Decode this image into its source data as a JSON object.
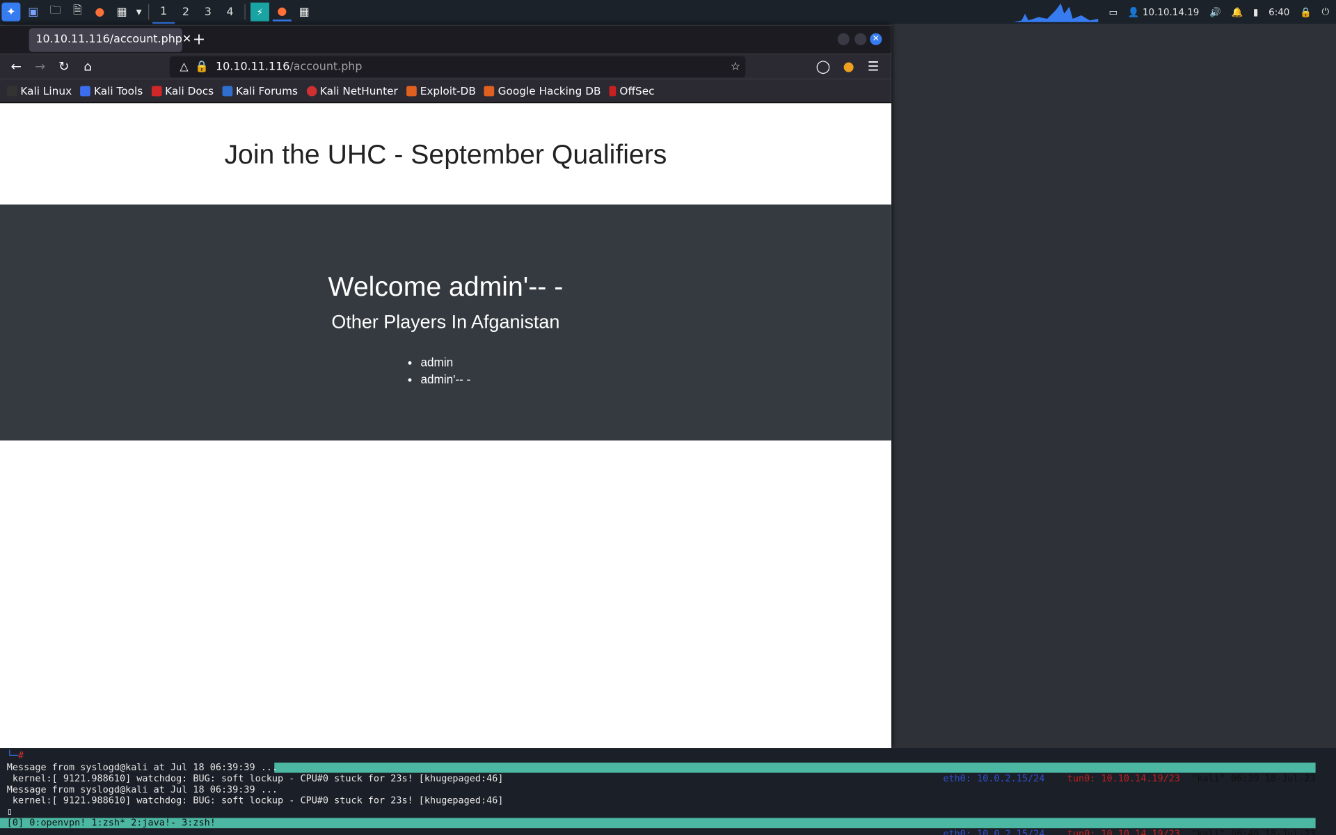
{
  "panel": {
    "workspaces": [
      "1",
      "2",
      "3",
      "4"
    ],
    "ip": "10.10.14.19",
    "time": "6:40"
  },
  "browser": {
    "tab_title": "10.10.11.116/account.php",
    "url_host": "10.10.11.116",
    "url_path": "/account.php",
    "bookmarks": [
      "Kali Linux",
      "Kali Tools",
      "Kali Docs",
      "Kali Forums",
      "Kali NetHunter",
      "Exploit-DB",
      "Google Hacking DB",
      "OffSec"
    ]
  },
  "page": {
    "header": "Join the UHC - September Qualifiers",
    "welcome": "Welcome admin'-- -",
    "subtitle": "Other Players In Afganistan",
    "players": [
      "admin",
      "admin'-- -"
    ]
  },
  "terminal": {
    "line1": "Message from syslogd@kali at Jul 18 06:39:39 ...",
    "line2": " kernel:[ 9121.988610] watchdog: BUG: soft lockup - CPU#0 stuck for 23s! [khugepaged:46]",
    "line3": "Message from syslogd@kali at Jul 18 06:39:39 ...",
    "line4": " kernel:[ 9121.988610] watchdog: BUG: soft lockup - CPU#0 stuck for 23s! [khugepaged:46]",
    "status1": {
      "eth0": "eth0: 10.0.2.15/24",
      "tun0": "tun0: 10.10.14.19/23",
      "host": "\"kali\" 06:39 18-Jul-23"
    },
    "status2": {
      "windows": "[0] 0:openvpn! 1:zsh* 2:java!- 3:zsh!",
      "eth0": "eth0: 10.0.2.15/24",
      "tun0": "tun0: 10.10.14.19/23",
      "host": "\"kali\" 06:40 18-Jul-23"
    }
  }
}
